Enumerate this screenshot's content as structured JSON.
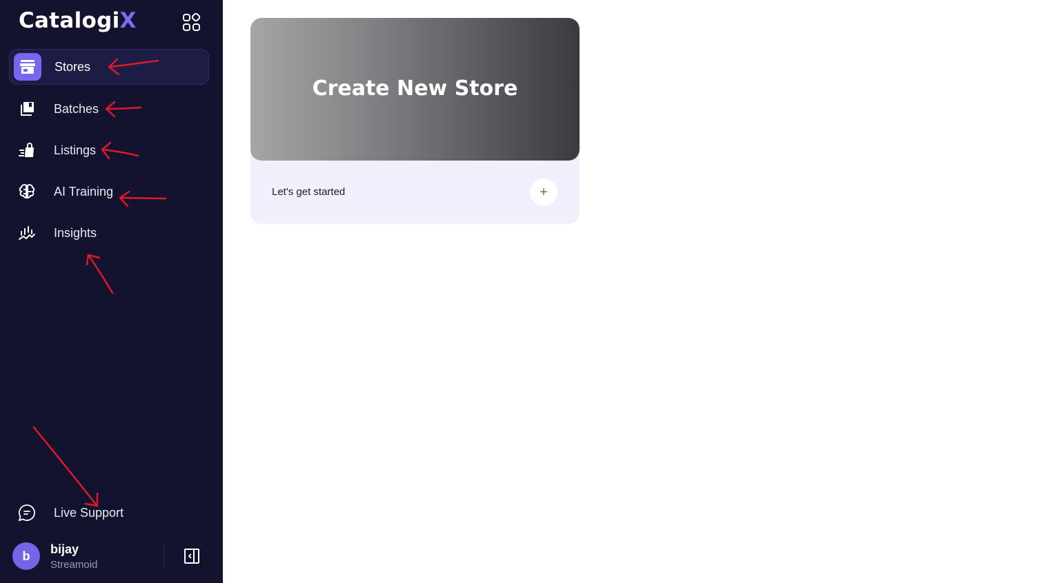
{
  "brand": {
    "name_main": "Catalogi",
    "name_accent": "X",
    "accent_color": "#7b6cf6"
  },
  "sidebar": {
    "items": [
      {
        "label": "Stores",
        "icon": "store-icon",
        "active": true
      },
      {
        "label": "Batches",
        "icon": "batches-icon",
        "active": false
      },
      {
        "label": "Listings",
        "icon": "listings-icon",
        "active": false
      },
      {
        "label": "AI Training",
        "icon": "brain-icon",
        "active": false
      },
      {
        "label": "Insights",
        "icon": "insights-icon",
        "active": false
      }
    ],
    "support": {
      "label": "Live Support",
      "icon": "chat-icon"
    },
    "user": {
      "initial": "b",
      "name": "bijay",
      "org": "Streamoid"
    }
  },
  "main": {
    "card": {
      "title": "Create New Store",
      "subtitle": "Let's get started",
      "action": "+"
    }
  },
  "colors": {
    "sidebar_bg": "#13132f",
    "active_accent": "#7767ef",
    "annotation_red": "#e0192a"
  }
}
